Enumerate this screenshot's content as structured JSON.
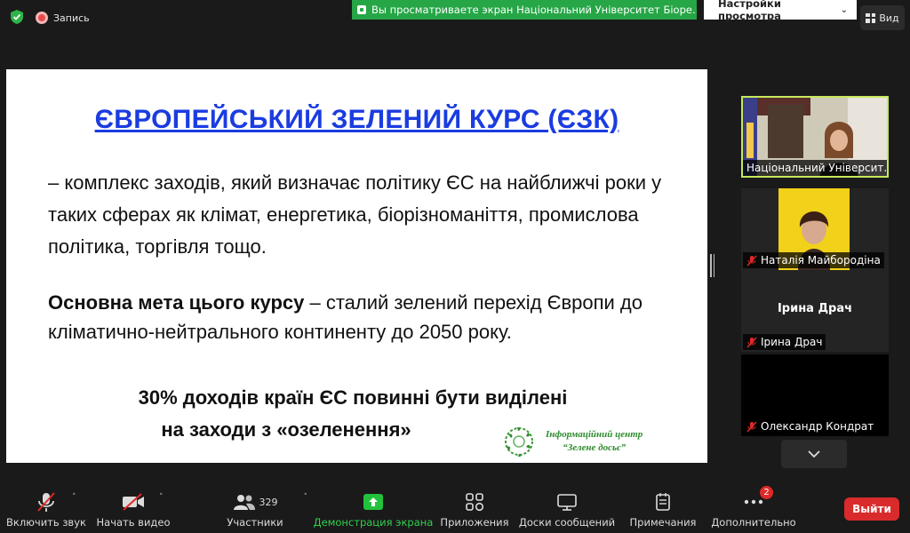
{
  "topbar": {
    "record_label": "Запись",
    "share_banner": "Вы просматриваете экран Національний Університет Біоре...",
    "view_settings_label": "Настройки просмотра",
    "view_label": "Вид"
  },
  "slide": {
    "title": "ЄВРОПЕЙСЬКИЙ ЗЕЛЕНИЙ КУРС (ЄЗК)",
    "paragraph1": "– комплекс заходів, який визначає політику ЄС на найближчі роки у таких сферах як клімат, енергетика, біорізноманіття, промислова політика, торгівля тощо.",
    "paragraph2_bold": "Основна мета цього курсу",
    "paragraph2_rest": " – сталий зелений перехід Європи до кліматично-нейтрального континенту до 2050 року.",
    "paragraph3_line1": "30% доходів країн ЄС повинні бути виділені",
    "paragraph3_line2": "на заходи з «озеленення»",
    "logo_line1": "Інформаційний центр",
    "logo_line2": "“Зелене досьє”"
  },
  "participants": [
    {
      "name": "Національний Університ...",
      "active": true,
      "video": true,
      "muted": false
    },
    {
      "name": "Наталія Майбородіна",
      "active": false,
      "video": true,
      "muted": true
    },
    {
      "name": "Ірина Драч",
      "display_name": "Ірина Драч",
      "active": false,
      "video": false,
      "muted": true
    },
    {
      "name": "Олександр Кондрат",
      "active": false,
      "video": false,
      "muted": true
    }
  ],
  "toolbar": {
    "unmute_label": "Включить звук",
    "video_label": "Начать видео",
    "participants_label": "Участники",
    "participants_count": "329",
    "share_label": "Демонстрация экрана",
    "apps_label": "Приложения",
    "whiteboards_label": "Доски сообщений",
    "notes_label": "Примечания",
    "more_label": "Дополнительно",
    "more_badge": "2",
    "leave_label": "Выйти"
  },
  "colors": {
    "share_green": "#26a646",
    "active_border": "#c6e85b",
    "leave_red": "#d92b2b",
    "title_blue": "#1a3ce0"
  }
}
